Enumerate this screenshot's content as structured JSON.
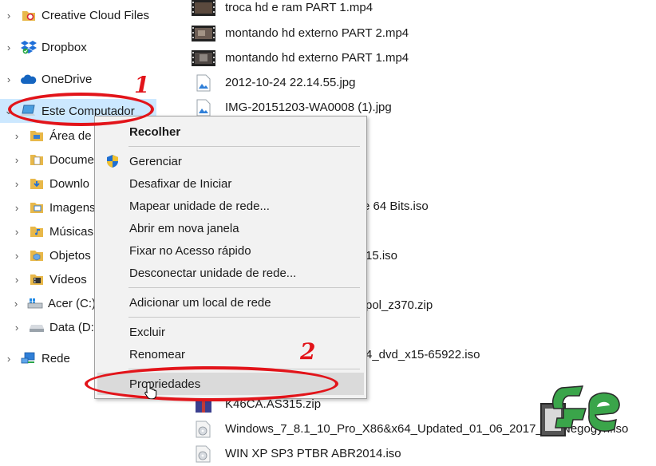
{
  "sidebar": {
    "items": [
      {
        "label": "Creative Cloud Files",
        "icon": "creative-cloud-folder-icon",
        "expandable": true
      },
      {
        "label": "Dropbox",
        "icon": "dropbox-icon",
        "expandable": true
      },
      {
        "label": "OneDrive",
        "icon": "onedrive-cloud-icon",
        "expandable": true
      },
      {
        "label": "Este Computador",
        "icon": "computer-icon",
        "expandable": true,
        "expanded": true,
        "selected": true
      },
      {
        "label": "Área de",
        "icon": "desktop-folder-icon",
        "expandable": true
      },
      {
        "label": "Docume",
        "icon": "documents-folder-icon",
        "expandable": true
      },
      {
        "label": "Downlo",
        "icon": "downloads-folder-icon",
        "expandable": true
      },
      {
        "label": "Imagens",
        "icon": "pictures-folder-icon",
        "expandable": true
      },
      {
        "label": "Músicas",
        "icon": "music-folder-icon",
        "expandable": true
      },
      {
        "label": "Objetos",
        "icon": "3d-objects-folder-icon",
        "expandable": true
      },
      {
        "label": "Vídeos",
        "icon": "videos-folder-icon",
        "expandable": true
      },
      {
        "label": "Acer (C:)",
        "icon": "windows-drive-icon",
        "expandable": true
      },
      {
        "label": "Data (D:",
        "icon": "drive-icon",
        "expandable": true
      },
      {
        "label": "Rede",
        "icon": "network-icon",
        "expandable": true
      }
    ]
  },
  "files": [
    {
      "name": "troca hd e ram PART 1.mp4",
      "icon": "video-file-icon"
    },
    {
      "name": "montando hd externo PART 2.mp4",
      "icon": "video-file-icon"
    },
    {
      "name": "montando hd externo PART 1.mp4",
      "icon": "video-file-icon"
    },
    {
      "name": "2012-10-24 22.14.55.jpg",
      "icon": "image-file-icon"
    },
    {
      "name": "IMG-20151203-WA0008 (1).jpg",
      "icon": "image-file-icon"
    },
    {
      "name": "e 64 Bits.iso",
      "icon": "disc-image-icon"
    },
    {
      "name": "15.iso",
      "icon": "disc-image-icon"
    },
    {
      "name": "pol_z370.zip",
      "icon": "zip-file-icon"
    },
    {
      "name": "4_dvd_x15-65922.iso",
      "icon": "disc-image-icon"
    },
    {
      "name": "K46CA.AS315.zip",
      "icon": "zip-file-icon"
    },
    {
      "name": "Windows_7_8.1_10_Pro_X86&x64_Updated_01_06_2017_by_Negogyn.iso",
      "icon": "disc-image-icon"
    },
    {
      "name": "WIN XP SP3 PTBR ABR2014.iso",
      "icon": "disc-image-icon"
    }
  ],
  "context_menu": {
    "items": [
      {
        "label": "Recolher",
        "bold": true
      },
      {
        "label": "Gerenciar",
        "icon": "uac-shield-icon"
      },
      {
        "label": "Desafixar de Iniciar"
      },
      {
        "label": "Mapear unidade de rede..."
      },
      {
        "label": "Abrir em nova janela"
      },
      {
        "label": "Fixar no Acesso rápido"
      },
      {
        "label": "Desconectar unidade de rede..."
      },
      {
        "label": "Adicionar um local de rede"
      },
      {
        "label": "Excluir"
      },
      {
        "label": "Renomear"
      },
      {
        "label": "Propriedades",
        "hover": true
      }
    ]
  },
  "annotations": {
    "step1": "1",
    "step2": "2",
    "color": "#e2141a"
  },
  "colors": {
    "selection": "#cce8ff",
    "menu_bg": "#f2f2f2",
    "menu_hover": "#dadada",
    "logo_green": "#3aa54a"
  }
}
